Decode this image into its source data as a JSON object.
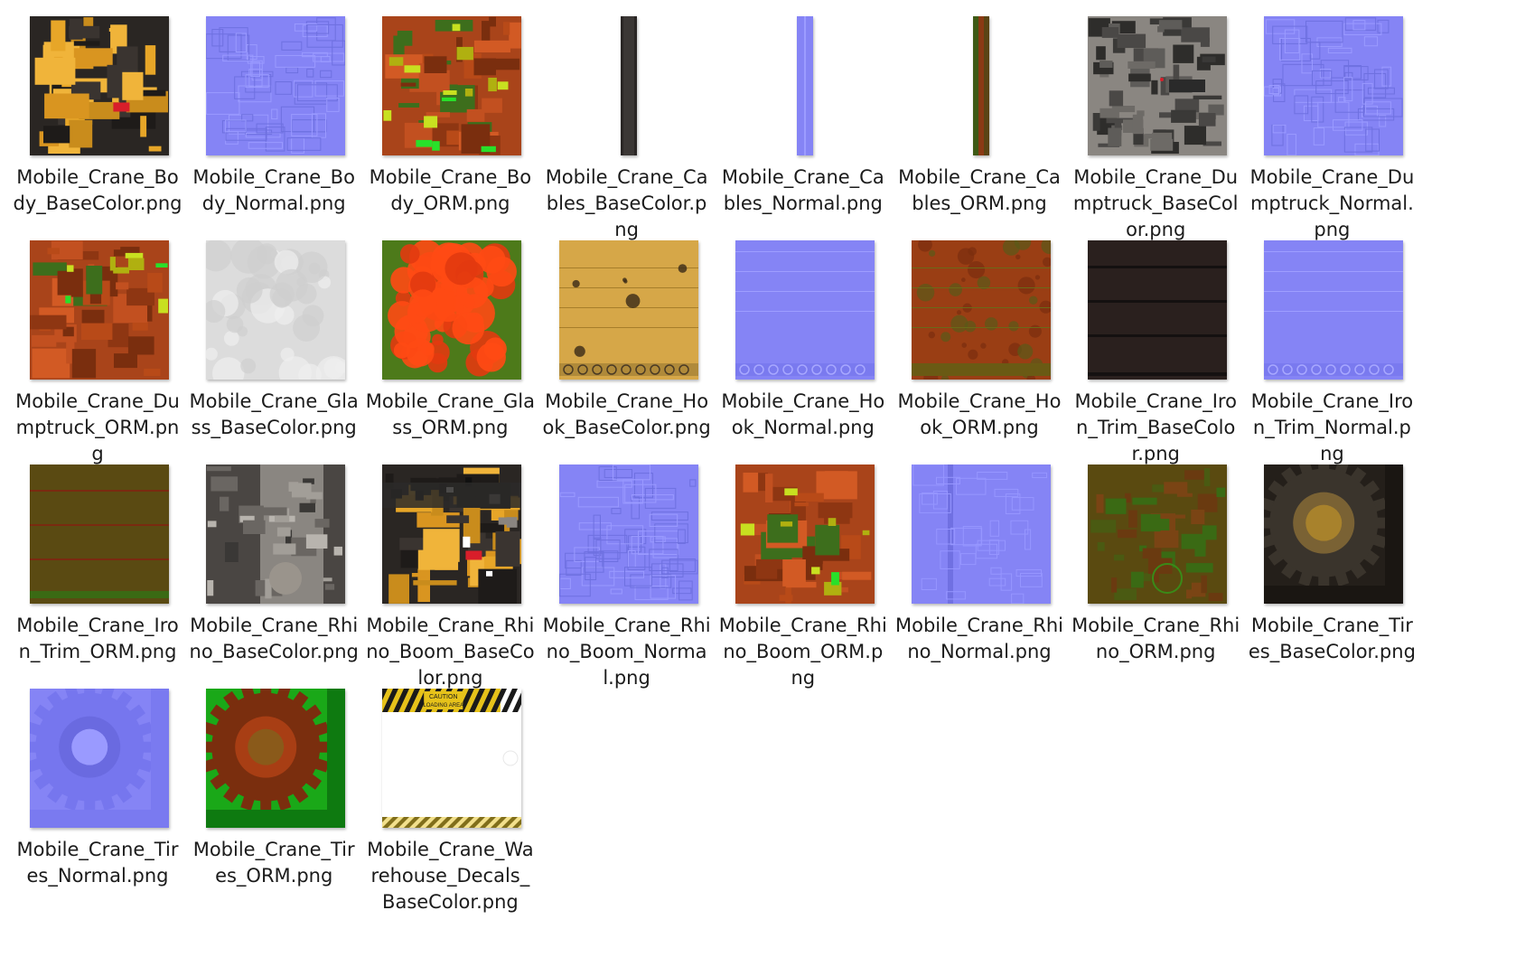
{
  "window": {
    "view": "Large icons"
  },
  "files": [
    {
      "name": "Mobile_Crane_Body_BaseColor.png",
      "thumb": "body-basecolor",
      "accent": "#e0a22a"
    },
    {
      "name": "Mobile_Crane_Body_Normal.png",
      "thumb": "normal-map",
      "accent": "#8080ff"
    },
    {
      "name": "Mobile_Crane_Body_ORM.png",
      "thumb": "body-orm",
      "accent": "#b84a18"
    },
    {
      "name": "Mobile_Crane_Cables_BaseColor.png",
      "thumb": "cables-basecolor",
      "accent": "#3a3634"
    },
    {
      "name": "Mobile_Crane_Cables_Normal.png",
      "thumb": "cables-normal",
      "accent": "#8080ff"
    },
    {
      "name": "Mobile_Crane_Cables_ORM.png",
      "thumb": "cables-orm",
      "accent": "#6a4a18"
    },
    {
      "name": "Mobile_Crane_Dumptruck_BaseColor.png",
      "thumb": "dumptruck-basecolor",
      "accent": "#7a7672"
    },
    {
      "name": "Mobile_Crane_Dumptruck_Normal.png",
      "thumb": "normal-map",
      "accent": "#8080ff"
    },
    {
      "name": "Mobile_Crane_Dumptruck_ORM.png",
      "thumb": "dumptruck-orm",
      "accent": "#a84214"
    },
    {
      "name": "Mobile_Crane_Glass_BaseColor.png",
      "thumb": "glass-basecolor",
      "accent": "#d8d8d8"
    },
    {
      "name": "Mobile_Crane_Glass_ORM.png",
      "thumb": "glass-orm",
      "accent": "#ff4a14"
    },
    {
      "name": "Mobile_Crane_Hook_BaseColor.png",
      "thumb": "hook-basecolor",
      "accent": "#d6a748"
    },
    {
      "name": "Mobile_Crane_Hook_Normal.png",
      "thumb": "hook-normal",
      "accent": "#8080ff"
    },
    {
      "name": "Mobile_Crane_Hook_ORM.png",
      "thumb": "hook-orm",
      "accent": "#9a3e14"
    },
    {
      "name": "Mobile_Crane_Iron_Trim_BaseColor.png",
      "thumb": "iron-basecolor",
      "accent": "#2a201e"
    },
    {
      "name": "Mobile_Crane_Iron_Trim_Normal.png",
      "thumb": "hook-normal",
      "accent": "#8080ff"
    },
    {
      "name": "Mobile_Crane_Iron_Trim_ORM.png",
      "thumb": "iron-orm",
      "accent": "#5a4a10"
    },
    {
      "name": "Mobile_Crane_Rhino_BaseColor.png",
      "thumb": "rhino-basecolor",
      "accent": "#5a5450"
    },
    {
      "name": "Mobile_Crane_Rhino_Boom_BaseColor.png",
      "thumb": "boom-basecolor",
      "accent": "#e0a22a"
    },
    {
      "name": "Mobile_Crane_Rhino_Boom_Normal.png",
      "thumb": "normal-map",
      "accent": "#8080ff"
    },
    {
      "name": "Mobile_Crane_Rhino_Boom_ORM.png",
      "thumb": "boom-orm",
      "accent": "#a84214"
    },
    {
      "name": "Mobile_Crane_Rhino_Normal.png",
      "thumb": "rhino-normal",
      "accent": "#8080ff"
    },
    {
      "name": "Mobile_Crane_Rhino_ORM.png",
      "thumb": "rhino-orm",
      "accent": "#5a4a10"
    },
    {
      "name": "Mobile_Crane_Tires_BaseColor.png",
      "thumb": "tires-basecolor",
      "accent": "#2a2620"
    },
    {
      "name": "Mobile_Crane_Tires_Normal.png",
      "thumb": "tires-normal",
      "accent": "#8080ff"
    },
    {
      "name": "Mobile_Crane_Tires_ORM.png",
      "thumb": "tires-orm",
      "accent": "#1aa818"
    },
    {
      "name": "Mobile_Crane_Warehouse_Decals_BaseColor.png",
      "thumb": "decals-basecolor",
      "accent": "#ffffff",
      "decal_text": [
        "CAUTION",
        "LOADING AREA"
      ]
    }
  ]
}
